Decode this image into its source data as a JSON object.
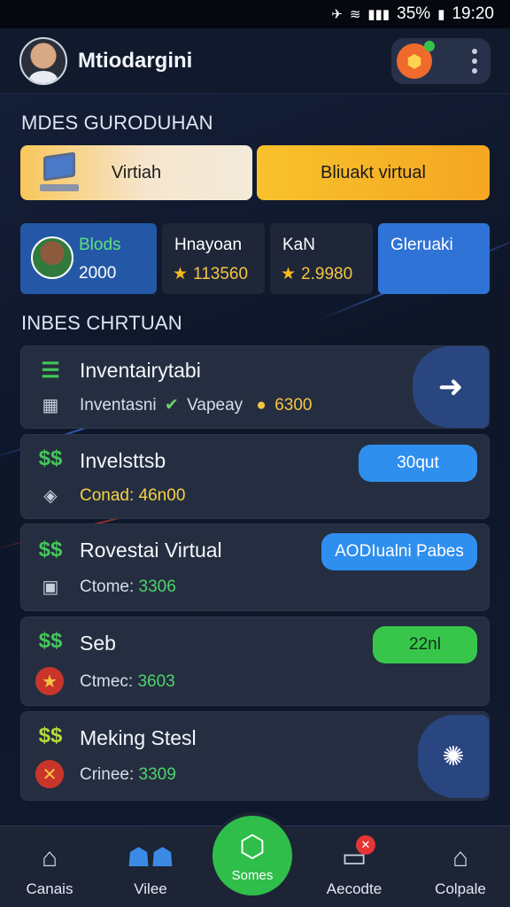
{
  "status_bar": {
    "battery": "35%",
    "time": "19:20"
  },
  "header": {
    "title": "Mtiodargini"
  },
  "mode_section": {
    "title": "MDES GURODUHAN",
    "virtual_label": "Virtiah",
    "real_label": "Bliuakt virtual"
  },
  "stats": [
    {
      "label": "Blods",
      "value": "2000"
    },
    {
      "label": "Hnayoan",
      "value": "113560"
    },
    {
      "label": "KaN",
      "value": "2.9980"
    },
    {
      "label": "Gleruaki"
    }
  ],
  "list_section": {
    "title": "INBES CHRTUAN"
  },
  "list_items": [
    {
      "title": "Inventairytabi",
      "sub_a": "Inventasni",
      "sub_b": "Vapeay",
      "sub_amount": "6300"
    },
    {
      "title": "Invelsttsb",
      "sub": "Conad: 46n00",
      "button": "30qut"
    },
    {
      "title": "Rovestai Virtual",
      "sub_prefix": "Ctome:",
      "sub_amount": "3306",
      "button": "AODIualni Pabes"
    },
    {
      "title": "Seb",
      "sub_prefix": "Ctmec:",
      "sub_amount": "3603",
      "button": "22nl"
    },
    {
      "title": "Meking Stesl",
      "sub_prefix": "Crinee:",
      "sub_amount": "3309"
    }
  ],
  "bottom_nav": [
    {
      "label": "Canais"
    },
    {
      "label": "Vilee"
    },
    {
      "label": "Somes"
    },
    {
      "label": "Aecodte"
    },
    {
      "label": "Colpale"
    }
  ],
  "colors": {
    "accent_orange": "#f5a622",
    "accent_blue": "#2f8fef",
    "accent_green": "#38c64a",
    "background": "#0e1628"
  }
}
